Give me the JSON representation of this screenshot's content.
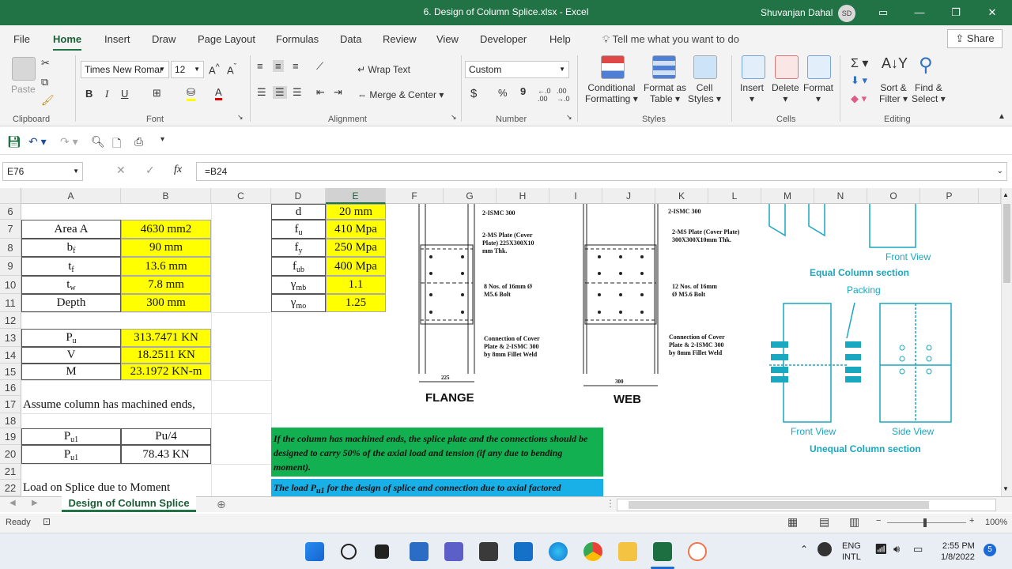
{
  "window": {
    "title": "6. Design of Column Splice.xlsx  -  Excel",
    "user_name": "Shuvanjan Dahal",
    "user_initials": "SD"
  },
  "menu": {
    "tabs": [
      "File",
      "Home",
      "Insert",
      "Draw",
      "Page Layout",
      "Formulas",
      "Data",
      "Review",
      "View",
      "Developer",
      "Help"
    ],
    "tell_me": "Tell me what you want to do",
    "share": "Share"
  },
  "ribbon": {
    "clipboard": {
      "paste": "Paste",
      "label": "Clipboard"
    },
    "font": {
      "name": "Times New Romar",
      "size": "12",
      "label": "Font",
      "bold": "B",
      "italic": "I",
      "underline": "U"
    },
    "alignment": {
      "wrap": "Wrap Text",
      "merge": "Merge & Center",
      "label": "Alignment"
    },
    "number": {
      "format": "Custom",
      "label": "Number",
      "currency": "$",
      "percent": "%",
      "comma": "9"
    },
    "styles": {
      "conditional": "Conditional",
      "conditional2": "Formatting",
      "format_as": "Format as",
      "format_as2": "Table",
      "cell": "Cell",
      "cell2": "Styles",
      "label": "Styles"
    },
    "cells": {
      "insert": "Insert",
      "delete": "Delete",
      "format": "Format",
      "label": "Cells"
    },
    "editing": {
      "sort": "Sort &",
      "sort2": "Filter",
      "find": "Find &",
      "find2": "Select",
      "label": "Editing"
    }
  },
  "formula_bar": {
    "name_box": "E76",
    "formula": "=B24",
    "fx": "fx"
  },
  "columns": [
    "A",
    "B",
    "C",
    "D",
    "E",
    "F",
    "G",
    "H",
    "I",
    "J",
    "K",
    "L",
    "M",
    "N",
    "O",
    "P"
  ],
  "rows": [
    "6",
    "7",
    "8",
    "9",
    "10",
    "11",
    "12",
    "13",
    "14",
    "15",
    "16",
    "17",
    "18",
    "19",
    "20",
    "21",
    "22"
  ],
  "cells": {
    "a7": "Area A",
    "b7": "4630 mm2",
    "a8_main": "b",
    "a8_sub": "f",
    "b8": "90 mm",
    "a9_main": "t",
    "a9_sub": "f",
    "b9": "13.6 mm",
    "a10_main": "t",
    "a10_sub": "w",
    "b10": "7.8 mm",
    "a11": "Depth",
    "b11": "300 mm",
    "d6": "d",
    "e6": "20 mm",
    "d7_main": "f",
    "d7_sub": "u",
    "e7": "410 Mpa",
    "d8_main": "f",
    "d8_sub": "y",
    "e8": "250 Mpa",
    "d9_main": "f",
    "d9_sub": "ub",
    "e9": "400 Mpa",
    "d10_main": "γ",
    "d10_sub": "mb",
    "e10": "1.1",
    "d11_main": "γ",
    "d11_sub": "mo",
    "e11": "1.25",
    "a13_main": "P",
    "a13_sub": "u",
    "b13": "313.7471 KN",
    "a14": "V",
    "b14": "18.2511 KN",
    "a15": "M",
    "b15": "23.1972 KN-m",
    "a17": "Assume column has machined ends,",
    "a19_main": "P",
    "a19_sub": "u1",
    "b19": "Pu/4",
    "a20_main": "P",
    "a20_sub": "u1",
    "b20": "78.43 KN",
    "a22": "Load on Splice due to Moment",
    "green_note": "If the column has machined ends, the splice plate and the connections should be designed to carry 50% of the axial load and tension (if any due to bending moment).",
    "blue_note_a": "The load P",
    "blue_note_sub": "u1",
    "blue_note_b": " for the design of splice and connection due to axial factored"
  },
  "drawing": {
    "flange_title": "FLANGE",
    "web_title": "WEB",
    "f_label1": "2-ISMC 300",
    "f_label2a": "2-MS Plate (Cover",
    "f_label2b": "Plate) 225X300X10",
    "f_label2c": "mm Thk.",
    "f_label3a": "8 Nos. of 16mm Ø",
    "f_label3b": "M5.6 Bolt",
    "f_label4a": "Connection of Cover",
    "f_label4b": "Plate & 2-ISMC 300",
    "f_label4c": "by 8mm Fillet Weld",
    "f_dim": "225",
    "w_label1": "2-ISMC 300",
    "w_label2a": "2-MS Plate (Cover Plate)",
    "w_label2b": "300X300X10mm Thk.",
    "w_label3a": "12 Nos. of 16mm",
    "w_label3b": "Ø M5.6 Bolt",
    "w_label4a": "Connection of Cover",
    "w_label4b": "Plate & 2-ISMC 300",
    "w_label4c": "by 8mm Fillet Weld",
    "w_dim": "300",
    "r_front1": "Front View",
    "r_equal": "Equal Column section",
    "r_packing": "Packing",
    "r_front2": "Front View",
    "r_side": "Side View",
    "r_unequal": "Unequal Column section"
  },
  "sheet_tab": "Design of Column Splice",
  "status": {
    "ready": "Ready",
    "zoom": "100%"
  },
  "taskbar": {
    "lang1": "ENG",
    "lang2": "INTL",
    "time": "2:55 PM",
    "date": "1/8/2022",
    "badge": "5"
  },
  "colors": {
    "excel_green": "#217346",
    "yellow": "#ffff00",
    "note_green": "#12b050",
    "note_blue": "#19b0e8",
    "drawing_cyan": "#1aa7c0"
  }
}
